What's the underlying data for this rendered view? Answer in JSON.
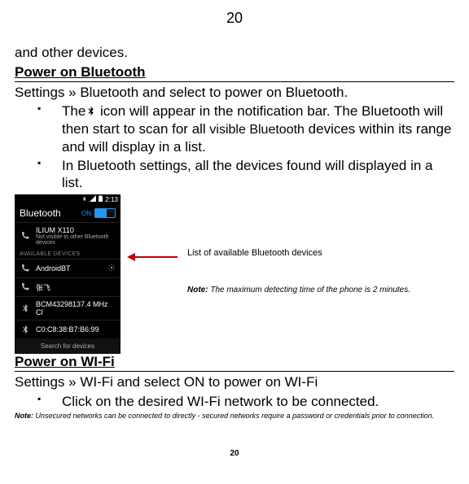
{
  "page_number_top": "20",
  "page_number_bottom": "20",
  "intro_line": "and other devices.",
  "section_bt_title": "Power on Bluetooth",
  "bt_path": "Settings » Bluetooth and select to power on Bluetooth.",
  "bt_bullet1_a": "The",
  "bt_icon_glyph": " ",
  "bt_bullet1_b": "icon will appear in the notification bar. The Bluetooth will then start to scan for all ",
  "bt_bullet1_c": "visible Bluetooth",
  "bt_bullet1_d": " devices within its range and will display in a list.",
  "bt_bullet2": "In Bluetooth settings, all the devices found will displayed in a list.",
  "screenshot": {
    "time": "2:13",
    "header": "Bluetooth",
    "toggle": "ON",
    "device_self": "ILIUM X110",
    "device_self_sub": "Not visible to other Bluetooth devices",
    "avail_label": "AVAILABLE DEVICES",
    "dev1": "AndroidBT",
    "dev2": "张飞",
    "dev3": "BCM43298137.4 MHz Cl",
    "dev4": "C0:C8:38:B7:B6:99",
    "search": "Search for devices"
  },
  "annotation_caption": "List of available Bluetooth devices",
  "annotation_note_label": "Note:",
  "annotation_note_body": " The maximum detecting time of the phone is 2 minutes.",
  "section_wifi_title": "Power on WI-Fi",
  "wifi_path": "Settings » WI-Fi and select ON to power on WI-Fi",
  "wifi_bullet1": "Click on the desired WI-Fi network to be connected.",
  "wifi_note_label": "Note:",
  "wifi_note_body": " Unsecured networks can be connected to directly - secured networks require a password or credentials prior to connection."
}
